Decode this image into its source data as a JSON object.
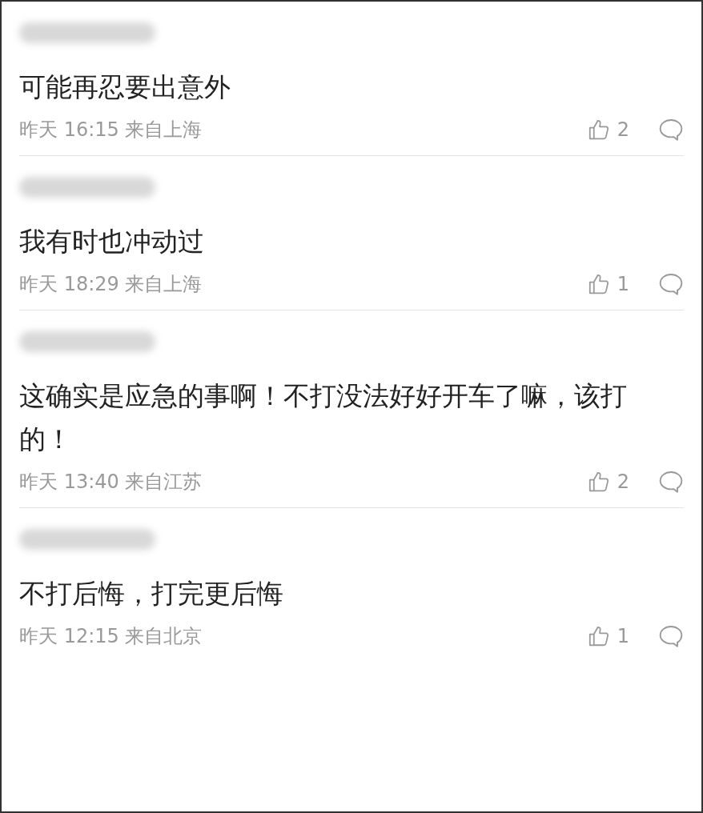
{
  "comments": [
    {
      "text": "可能再忍要出意外",
      "time": "昨天 16:15 来自上海",
      "likes": "2"
    },
    {
      "text": "我有时也冲动过",
      "time": "昨天 18:29 来自上海",
      "likes": "1"
    },
    {
      "text": "这确实是应急的事啊！不打没法好好开车了嘛，该打的！",
      "time": "昨天 13:40 来自江苏",
      "likes": "2"
    },
    {
      "text": "不打后悔，打完更后悔",
      "time": "昨天 12:15 来自北京",
      "likes": "1"
    }
  ]
}
